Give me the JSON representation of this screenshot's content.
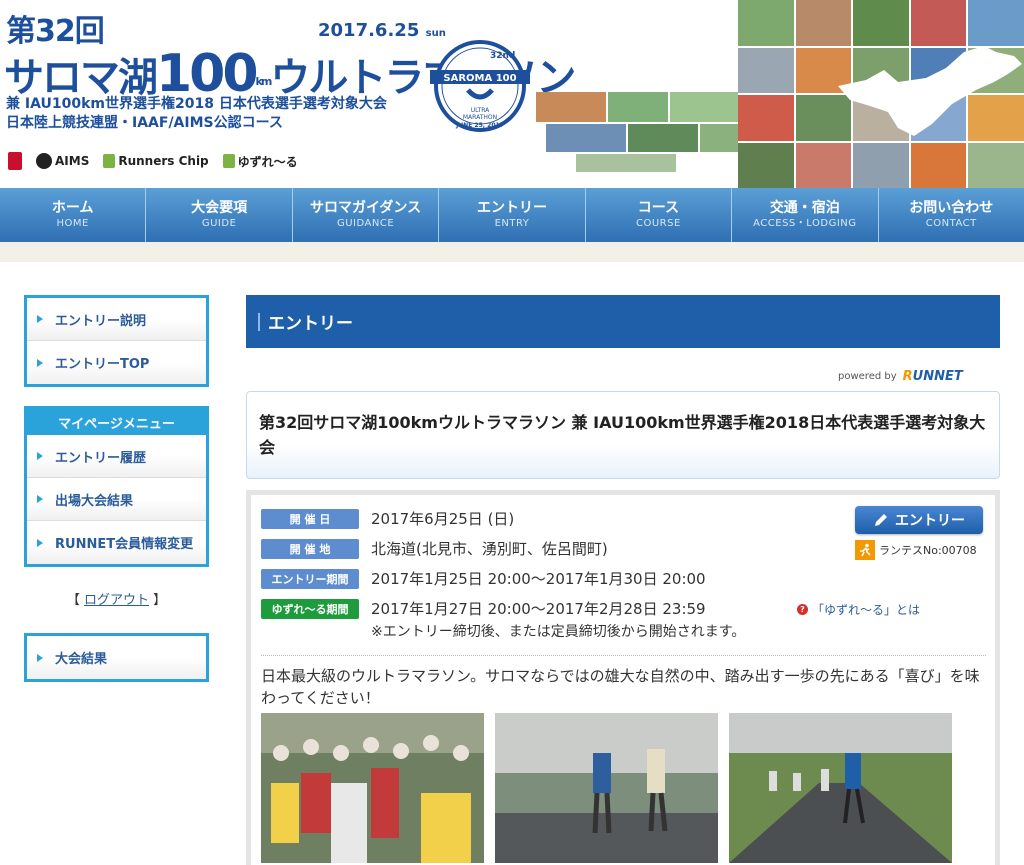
{
  "header": {
    "title_line1": "第32回",
    "title_name_a": "サロマ湖",
    "title_name_b": "100",
    "title_name_unit": "km",
    "title_name_c": "ウルトラマラソン",
    "date": "2017.6.25",
    "date_day": "sun",
    "subtitle1": "兼 IAU100km世界選手権2018 日本代表選手選考対象大会",
    "subtitle2": "日本陸上競技連盟・IAAF/AIMS公認コース",
    "badge_num": "32nd",
    "badge_name": "SAROMA 100",
    "badge_sub1": "ULTRA",
    "badge_sub2": "MARATHON",
    "badge_date": "JUNE 25, 2017",
    "sponsors": [
      "AIMS",
      "Runners Chip",
      "ゆずれ〜る"
    ]
  },
  "nav": [
    {
      "jp": "ホーム",
      "en": "HOME"
    },
    {
      "jp": "大会要項",
      "en": "GUIDE"
    },
    {
      "jp": "サロマガイダンス",
      "en": "GUIDANCE"
    },
    {
      "jp": "エントリー",
      "en": "ENTRY"
    },
    {
      "jp": "コース",
      "en": "COURSE"
    },
    {
      "jp": "交通・宿泊",
      "en": "ACCESS・LODGING"
    },
    {
      "jp": "お問い合わせ",
      "en": "CONTACT"
    }
  ],
  "sidebar": {
    "entry_items": [
      "エントリー説明",
      "エントリーTOP"
    ],
    "mypage_title": "マイページメニュー",
    "mypage_items": [
      "エントリー履歴",
      "出場大会結果",
      "RUNNET会員情報変更"
    ],
    "logout_pre": "【",
    "logout": "ログアウト",
    "logout_post": "】",
    "results_items": [
      "大会結果"
    ]
  },
  "main": {
    "section_title": "エントリー",
    "powered_by": "powered by",
    "powered_logo_r": "R",
    "powered_logo": "UNNET",
    "event_title": "第32回サロマ湖100kmウルトラマラソン 兼 IAU100km世界選手権2018日本代表選手選考対象大会",
    "rows": [
      {
        "label": "開 催 日",
        "value": "2017年6月25日 (日)"
      },
      {
        "label": "開 催 地",
        "value": "北海道(北見市、湧別町、佐呂間町)"
      },
      {
        "label": "エントリー期間",
        "value": "2017年1月25日 20:00〜2017年1月30日 20:00"
      },
      {
        "label": "ゆずれ〜る期間",
        "value": "2017年1月27日 20:00〜2017年2月28日 23:59"
      }
    ],
    "note": "※エントリー締切後、または定員締切後から開始されます。",
    "help_link": "「ゆずれ〜る」とは",
    "entry_button": "エントリー",
    "runtes": "ランテスNo:00708",
    "description": "日本最大級のウルトラマラソン。サロマならではの雄大な自然の中、踏み出す一歩の先にある「喜び」を味わってください！"
  },
  "colors": {
    "brand_blue": "#1d4f9c",
    "nav_top": "#5b9fd6",
    "nav_bottom": "#2f6fb3",
    "sidebar_border": "#2aa3db",
    "section_title_bg": "#1f5fa9",
    "label_blue": "#5d8dcf",
    "label_green": "#1e9b3c",
    "accent_orange": "#f39800"
  }
}
